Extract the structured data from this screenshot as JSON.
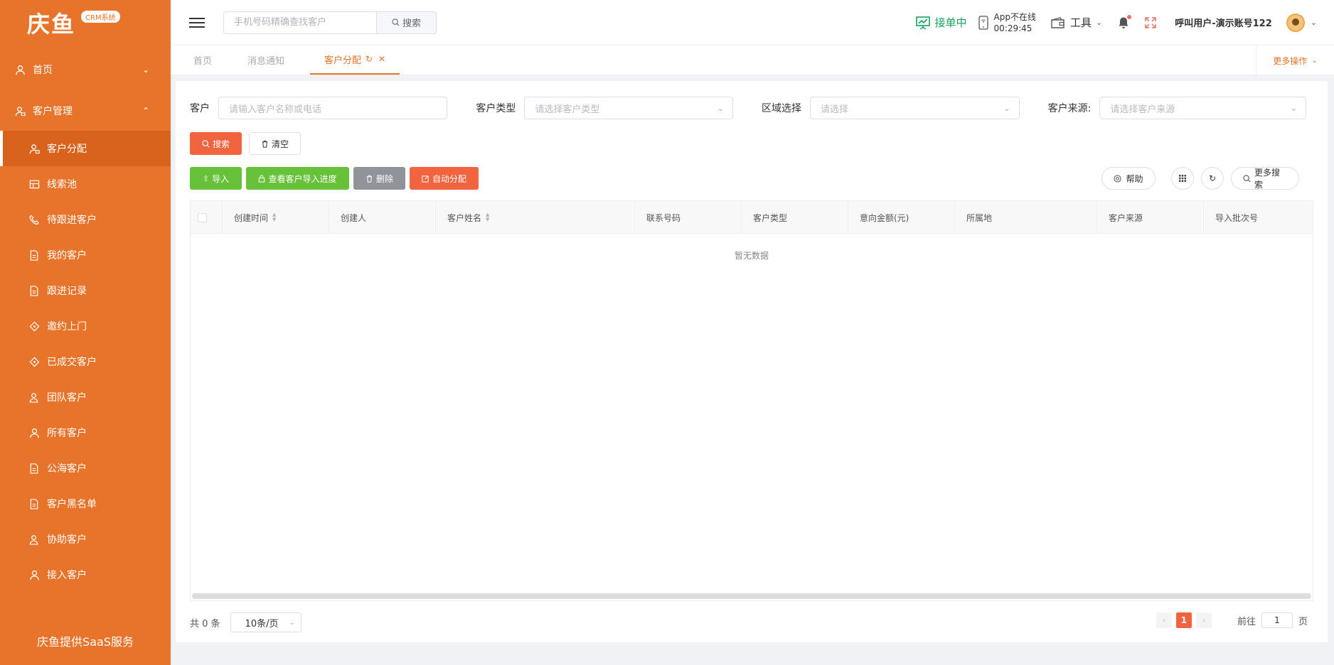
{
  "brand": {
    "logo_text": "庆鱼",
    "badge": "CRM系统",
    "footer": "庆鱼提供SaaS服务",
    "accent": "#e8732a"
  },
  "sidebar": {
    "home": {
      "label": "首页",
      "icon": "user-icon"
    },
    "group": {
      "label": "客户管理",
      "icon": "customers-icon"
    },
    "items": [
      {
        "label": "客户分配",
        "icon": "user-assign-icon",
        "active": true
      },
      {
        "label": "线索池",
        "icon": "grid-icon"
      },
      {
        "label": "待跟进客户",
        "icon": "phone-icon"
      },
      {
        "label": "我的客户",
        "icon": "document-icon"
      },
      {
        "label": "跟进记录",
        "icon": "document-icon"
      },
      {
        "label": "邀约上门",
        "icon": "tag-icon"
      },
      {
        "label": "已成交客户",
        "icon": "tag-icon"
      },
      {
        "label": "团队客户",
        "icon": "team-icon"
      },
      {
        "label": "所有客户",
        "icon": "user-icon"
      },
      {
        "label": "公海客户",
        "icon": "document-icon"
      },
      {
        "label": "客户黑名单",
        "icon": "document-icon"
      },
      {
        "label": "协助客户",
        "icon": "team-icon"
      },
      {
        "label": "接入客户",
        "icon": "user-icon"
      }
    ]
  },
  "header": {
    "search_placeholder": "手机号码精确查找客户",
    "search_button": "搜索",
    "status": "接单中",
    "app_status": "App不在线",
    "app_timer": "00:29:45",
    "tools": "工具",
    "user": "呼叫用户-演示账号122"
  },
  "tabs": {
    "items": [
      "首页",
      "消息通知",
      "客户分配"
    ],
    "active_index": 2,
    "more": "更多操作"
  },
  "filters": {
    "customer_label": "客户",
    "customer_placeholder": "请输入客户名称或电话",
    "type_label": "客户类型",
    "type_placeholder": "请选择客户类型",
    "region_label": "区域选择",
    "region_placeholder": "请选择",
    "source_label": "客户来源:",
    "source_placeholder": "请选择客户来源",
    "search": "搜索",
    "clear": "清空"
  },
  "actions": {
    "import": "导入",
    "view_progress": "查看客户导入进度",
    "delete": "删除",
    "auto_assign": "自动分配",
    "help": "帮助",
    "more_search": "更多搜索"
  },
  "table": {
    "columns": [
      "创建时间",
      "创建人",
      "客户姓名",
      "联系号码",
      "客户类型",
      "意向金额(元)",
      "所属地",
      "客户来源",
      "导入批次号"
    ],
    "empty_text": "暂无数据"
  },
  "pagination": {
    "total_text": "共 0 条",
    "page_size": "10条/页",
    "current_page": "1",
    "goto_label": "前往",
    "goto_value": "1",
    "page_unit": "页"
  }
}
